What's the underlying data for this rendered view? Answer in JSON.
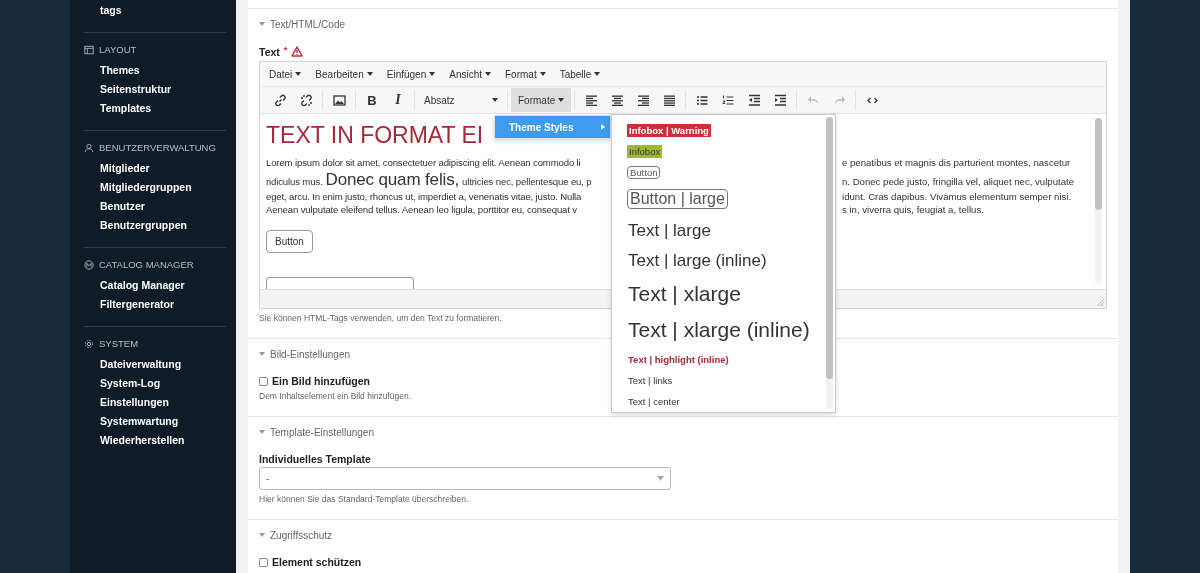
{
  "sidebar": {
    "cut_item": "tags",
    "sections": [
      {
        "title": "LAYOUT",
        "kind": "layout",
        "items": [
          "Themes",
          "Seitenstruktur",
          "Templates"
        ]
      },
      {
        "title": "BENUTZERVERWALTUNG",
        "kind": "user",
        "items": [
          "Mitglieder",
          "Mitgliedergruppen",
          "Benutzer",
          "Benutzergruppen"
        ]
      },
      {
        "title": "CATALOG MANAGER",
        "kind": "catalog",
        "items": [
          "Catalog Manager",
          "Filtergenerator"
        ]
      },
      {
        "title": "SYSTEM",
        "kind": "system",
        "items": [
          "Dateiverwaltung",
          "System-Log",
          "Einstellungen",
          "Systemwartung",
          "Wiederherstellen"
        ]
      }
    ]
  },
  "editor_section": {
    "title": "Text/HTML/Code",
    "expanded": true,
    "field_label": "Text",
    "required_mark": "*",
    "warning": true,
    "menubar": [
      "Datei",
      "Bearbeiten",
      "Einfügen",
      "Ansicht",
      "Format",
      "Tabelle"
    ],
    "toolbar": {
      "bold": "B",
      "italic": "I",
      "block_select": "Absatz",
      "formats_button": {
        "label": "Formate",
        "expanded": true
      },
      "history": [
        {
          "kind": "undo",
          "disabled": true
        },
        {
          "kind": "redo",
          "disabled": true
        }
      ]
    },
    "formats_menu": {
      "items": [
        {
          "label": "Theme Styles",
          "selected": true
        }
      ],
      "submenu": [
        {
          "label": "Infobox | Warning",
          "kind": "warning"
        },
        {
          "label": "Infobox",
          "kind": "infobox"
        },
        {
          "label": "Button",
          "kind": "button"
        },
        {
          "label": "Button | large",
          "kind": "button-large"
        },
        {
          "label": "Text | large",
          "kind": "large"
        },
        {
          "label": "Text | large (inline)",
          "kind": "large"
        },
        {
          "label": "Text | xlarge",
          "kind": "xlarge"
        },
        {
          "label": "Text | xlarge (inline)",
          "kind": "xlarge"
        },
        {
          "label": "Text | highlight (inline)",
          "kind": "highlight"
        },
        {
          "label": "Text | links",
          "kind": "plain"
        },
        {
          "label": "Text | center",
          "kind": "plain"
        }
      ]
    },
    "content": {
      "heading": "TEXT IN FORMAT EI",
      "lines": [
        {
          "left": [
            {
              "text": "Lorem ipsum dolor sit amet, consectetuer adipiscing elit. Aenean commodo li",
              "kind": "normal"
            }
          ],
          "right": "e penatibus et magnis dis parturient montes, nascetur"
        },
        {
          "left": [
            {
              "text": "ridiculus mus.",
              "kind": "normal"
            },
            {
              "text": "Donec quam felis,",
              "kind": "large"
            },
            {
              "text": "ultricies nec, pellentesque eu, p",
              "kind": "normal"
            }
          ],
          "right": "n. Donec pede justo, fringilla vel, aliquet nec, vulputate"
        },
        {
          "left": [
            {
              "text": "eget, arcu. In enim justo, rhoncus ut, imperdiet a, venenatis vitae, justo. Nulla",
              "kind": "normal"
            }
          ],
          "right": "idunt. Cras dapibus. Vivamus elementum semper nisi."
        },
        {
          "left": [
            {
              "text": "Aenean vulputate eleifend tellus. Aenean leo ligula, porttitor eu, consequat v",
              "kind": "normal"
            }
          ],
          "right": "s in, viverra quis, feugiat a, tellus."
        }
      ],
      "button": "Button"
    },
    "help": "Sie können HTML-Tags verwenden, um den Text zu formatieren."
  },
  "sections": [
    {
      "title": "Bild-Einstellungen",
      "expanded": true,
      "kind": "checkbox",
      "label": "Ein Bild hinzufügen",
      "checked": false,
      "help": "Dem Inhaltselement ein Bild hinzufügen."
    },
    {
      "title": "Template-Einstellungen",
      "expanded": true,
      "kind": "select",
      "label": "Individuelles Template",
      "value": "-",
      "help": "Hier können Sie das Standard-Template überschreiben."
    },
    {
      "title": "Zugriffsschutz",
      "expanded": true,
      "kind": "checkbox",
      "label": "Element schützen",
      "checked": false
    }
  ]
}
